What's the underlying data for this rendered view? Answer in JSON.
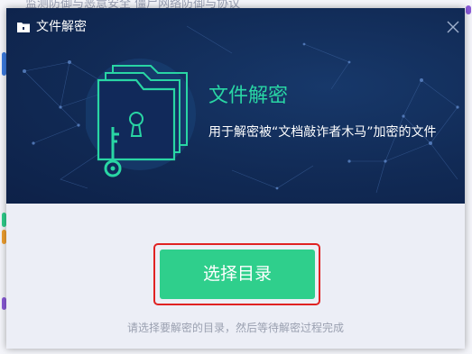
{
  "background_app": {
    "top_text": "监测防御与恶意安全            僵尸网络防御与协议"
  },
  "dialog": {
    "title": "文件解密",
    "close_icon": "close-icon",
    "title_icon": "folder-icon",
    "hero": {
      "heading": "文件解密",
      "description": "用于解密被“文档敲诈者木马”加密的文件",
      "illustration_icon": "locked-folder-key-icon"
    },
    "primary_button": "选择目录",
    "hint": "请选择要解密的目录，然后等待解密过程完成"
  },
  "colors": {
    "hero_bg": "#112a55",
    "accent_green": "#2fcf8c",
    "heading_green": "#29d6a4",
    "highlight_red": "#e02222"
  }
}
